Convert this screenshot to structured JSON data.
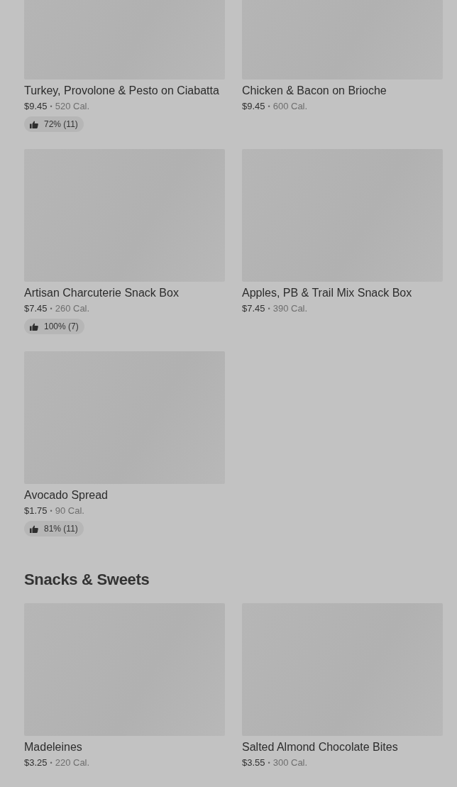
{
  "sections": [
    {
      "items": [
        {
          "name": "Turkey, Provolone & Pesto on Ciabatta",
          "price": "$9.45",
          "dot": "•",
          "calories": "520 Cal.",
          "rating": "72% (11)"
        },
        {
          "name": "Chicken & Bacon on Brioche",
          "price": "$9.45",
          "dot": "•",
          "calories": "600 Cal."
        },
        {
          "name": "Artisan Charcuterie Snack Box",
          "price": "$7.45",
          "dot": "•",
          "calories": "260 Cal.",
          "rating": "100% (7)"
        },
        {
          "name": "Apples, PB & Trail Mix Snack Box",
          "price": "$7.45",
          "dot": "•",
          "calories": "390 Cal."
        },
        {
          "name": "Avocado Spread",
          "price": "$1.75",
          "dot": "•",
          "calories": "90 Cal.",
          "rating": "81% (11)"
        }
      ]
    },
    {
      "title": "Snacks & Sweets",
      "items": [
        {
          "name": "Madeleines",
          "price": "$3.25",
          "dot": "•",
          "calories": "220 Cal."
        },
        {
          "name": "Salted Almond Chocolate Bites",
          "price": "$3.55",
          "dot": "•",
          "calories": "300 Cal."
        }
      ]
    }
  ]
}
